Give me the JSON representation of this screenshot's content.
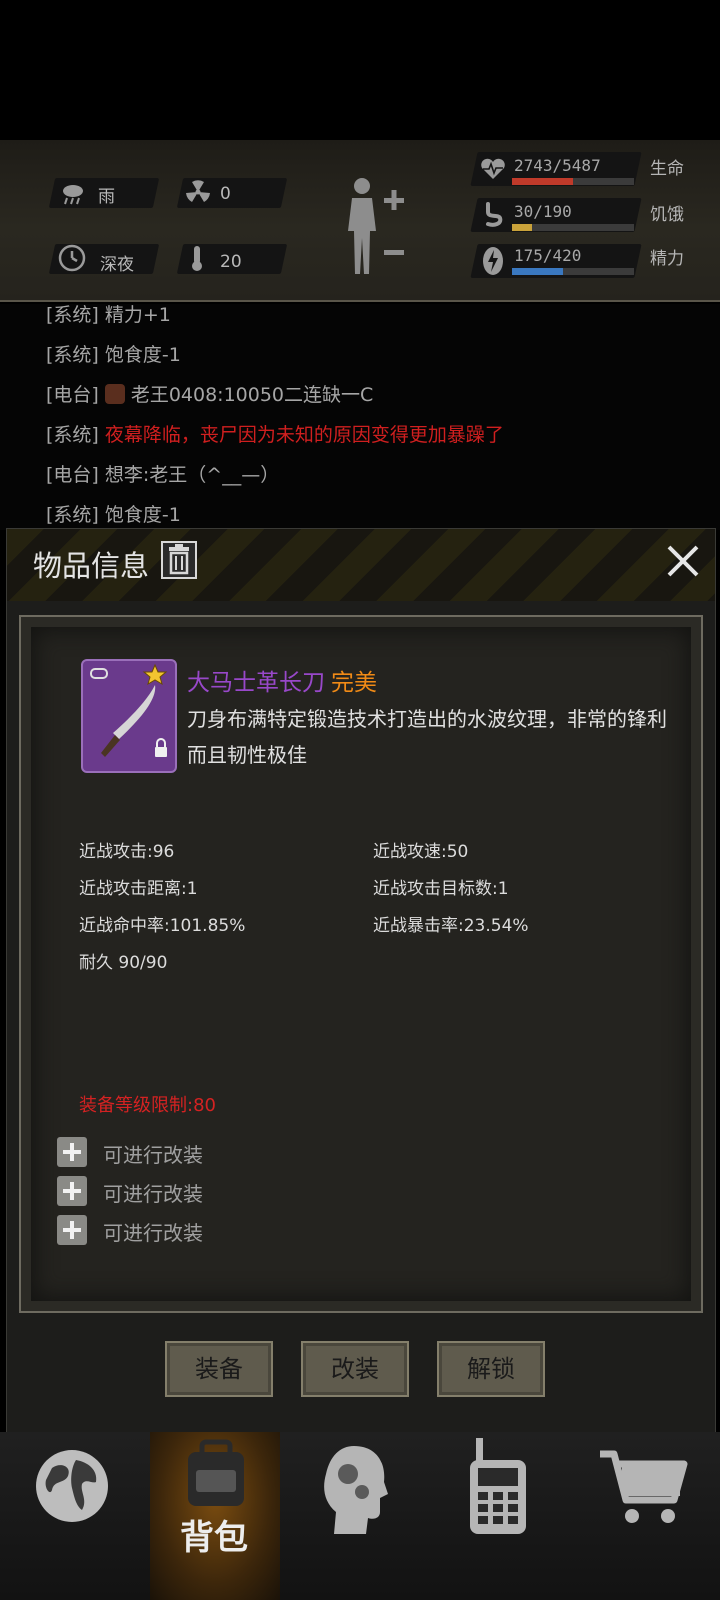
{
  "status": {
    "weather": "雨",
    "radiation": "0",
    "time_of_day": "深夜",
    "temperature": "20",
    "life": {
      "value": "2743/5487",
      "label": "生命",
      "fraction": 0.5,
      "color": "#c03a2a"
    },
    "hunger": {
      "value": "30/190",
      "label": "饥饿",
      "fraction": 0.16,
      "color": "#c9a23a"
    },
    "energy": {
      "value": "175/420",
      "label": "精力",
      "fraction": 0.42,
      "color": "#3a78c0"
    }
  },
  "chat": [
    {
      "tag": "[系统]",
      "text": "精力+1",
      "red": false
    },
    {
      "tag": "[系统]",
      "text": "饱食度-1",
      "red": false
    },
    {
      "tag": "[电台]",
      "text": "老王0408:10050二连缺一C",
      "red": false
    },
    {
      "tag": "[系统]",
      "text": "夜幕降临，丧尸因为未知的原因变得更加暴躁了",
      "red": true
    },
    {
      "tag": "[电台]",
      "text": "想李:老王（^__—）",
      "red": false
    },
    {
      "tag": "[系统]",
      "text": "饱食度-1",
      "red": false
    }
  ],
  "dialog": {
    "title": "物品信息",
    "item_name": "大马士革长刀",
    "item_quality": "完美",
    "item_description": "刀身布满特定锻造技术打造出的水波纹理，非常的锋利而且韧性极佳",
    "stats": {
      "melee_attack": "近战攻击:96",
      "melee_speed": "近战攻速:50",
      "melee_range": "近战攻击距离:1",
      "melee_targets": "近战攻击目标数:1",
      "melee_hit": "近战命中率:101.85%",
      "melee_crit": "近战暴击率:23.54%",
      "durability": "耐久 90/90"
    },
    "requirement": "装备等级限制:80",
    "mods": [
      "可进行改装",
      "可进行改装",
      "可进行改装"
    ],
    "buttons": {
      "equip": "装备",
      "modify": "改装",
      "unlock": "解锁"
    }
  },
  "nav": {
    "active_label": "背包"
  }
}
